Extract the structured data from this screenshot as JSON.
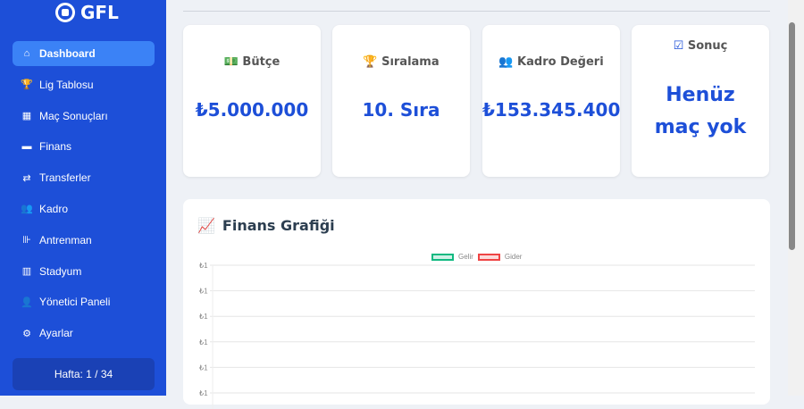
{
  "app": {
    "title": "GFL"
  },
  "sidebar": {
    "items": [
      {
        "label": "Dashboard",
        "icon": "home-icon",
        "glyph": "⌂"
      },
      {
        "label": "Lig Tablosu",
        "icon": "trophy-icon",
        "glyph": "🏆"
      },
      {
        "label": "Maç Sonuçları",
        "icon": "calendar-icon",
        "glyph": "▦"
      },
      {
        "label": "Finans",
        "icon": "wallet-icon",
        "glyph": "▬"
      },
      {
        "label": "Transferler",
        "icon": "exchange-icon",
        "glyph": "⇄"
      },
      {
        "label": "Kadro",
        "icon": "users-icon",
        "glyph": "👥"
      },
      {
        "label": "Antrenman",
        "icon": "dumbbell-icon",
        "glyph": "⊪"
      },
      {
        "label": "Stadyum",
        "icon": "building-icon",
        "glyph": "▥"
      },
      {
        "label": "Yönetici Paneli",
        "icon": "user-cog-icon",
        "glyph": "👤"
      },
      {
        "label": "Ayarlar",
        "icon": "cogs-icon",
        "glyph": "⚙"
      }
    ],
    "week": "Hafta: 1 / 34"
  },
  "cards": [
    {
      "title": "Bütçe",
      "value": "₺5.000.000",
      "icon": "money-icon",
      "glyph": "💵"
    },
    {
      "title": "Sıralama",
      "value": "10. Sıra",
      "icon": "trophy-icon",
      "glyph": "🏆"
    },
    {
      "title": "Kadro Değeri",
      "value": "₺153.345.400",
      "icon": "users-icon",
      "glyph": "👥"
    },
    {
      "title": "Sonuç",
      "value": "Henüz maç yok",
      "icon": "calendar-check-icon",
      "glyph": "☑"
    }
  ],
  "chart_data": {
    "type": "bar",
    "title": "Finans Grafiği",
    "series": [
      {
        "name": "Gelir",
        "color": "#10b981",
        "values": []
      },
      {
        "name": "Gider",
        "color": "#ef4444",
        "values": []
      }
    ],
    "yticks": [
      "₺1",
      "₺1",
      "₺1",
      "₺1",
      "₺1",
      "₺1"
    ],
    "legend": "top"
  }
}
